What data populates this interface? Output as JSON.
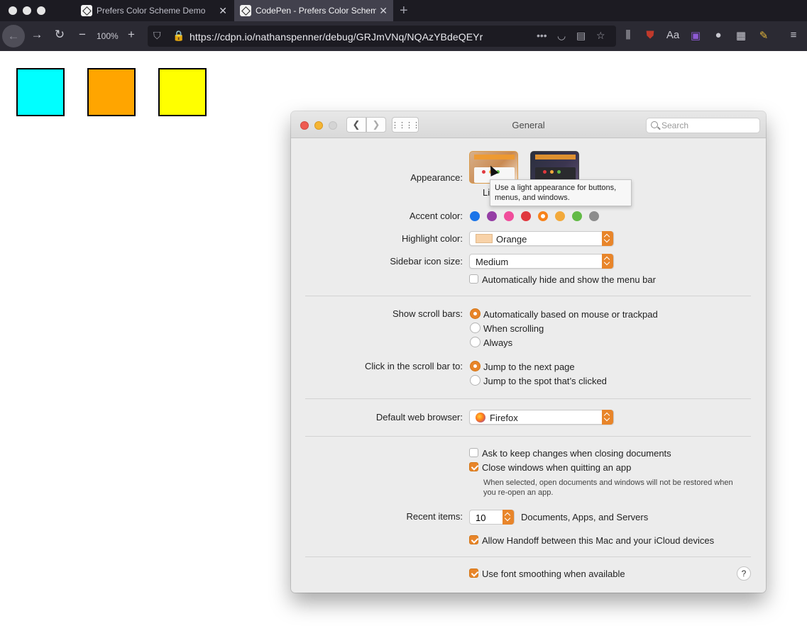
{
  "browser": {
    "tabs": [
      {
        "title": "Prefers Color Scheme Demo",
        "active": false
      },
      {
        "title": "CodePen - Prefers Color Schem",
        "active": true
      }
    ],
    "zoom": "100%",
    "url": "https://cdpn.io/nathanspenner/debug/GRJmVNq/NQAzYBdeQEYr"
  },
  "page": {
    "swatches": [
      "#00ffff",
      "#ffa500",
      "#ffff00"
    ]
  },
  "prefs": {
    "title": "General",
    "search_placeholder": "Search",
    "appearance_label": "Appearance:",
    "appearance_partial": "Li",
    "tooltip": "Use a light appearance for buttons, menus, and windows.",
    "accent_label": "Accent color:",
    "accent_colors": [
      "#1b74e8",
      "#953ea5",
      "#f04d9b",
      "#e0383e",
      "#f7821b",
      "#f2a93b",
      "#62ba46",
      "#8c8c8c"
    ],
    "accent_selected_index": 4,
    "highlight_label": "Highlight color:",
    "highlight_value": "Orange",
    "sidebar_label": "Sidebar icon size:",
    "sidebar_value": "Medium",
    "menubar_checkbox": "Automatically hide and show the menu bar",
    "scroll_label": "Show scroll bars:",
    "scroll_options": [
      "Automatically based on mouse or trackpad",
      "When scrolling",
      "Always"
    ],
    "click_label": "Click in the scroll bar to:",
    "click_options": [
      "Jump to the next page",
      "Jump to the spot that’s clicked"
    ],
    "browser_label": "Default web browser:",
    "browser_value": "Firefox",
    "ask_keep_changes": "Ask to keep changes when closing documents",
    "close_windows": "Close windows when quitting an app",
    "close_windows_note": "When selected, open documents and windows will not be restored when you re-open an app.",
    "recent_label": "Recent items:",
    "recent_value": "10",
    "recent_suffix": "Documents, Apps, and Servers",
    "handoff": "Allow Handoff between this Mac and your iCloud devices",
    "font_smoothing": "Use font smoothing when available",
    "help": "?"
  }
}
